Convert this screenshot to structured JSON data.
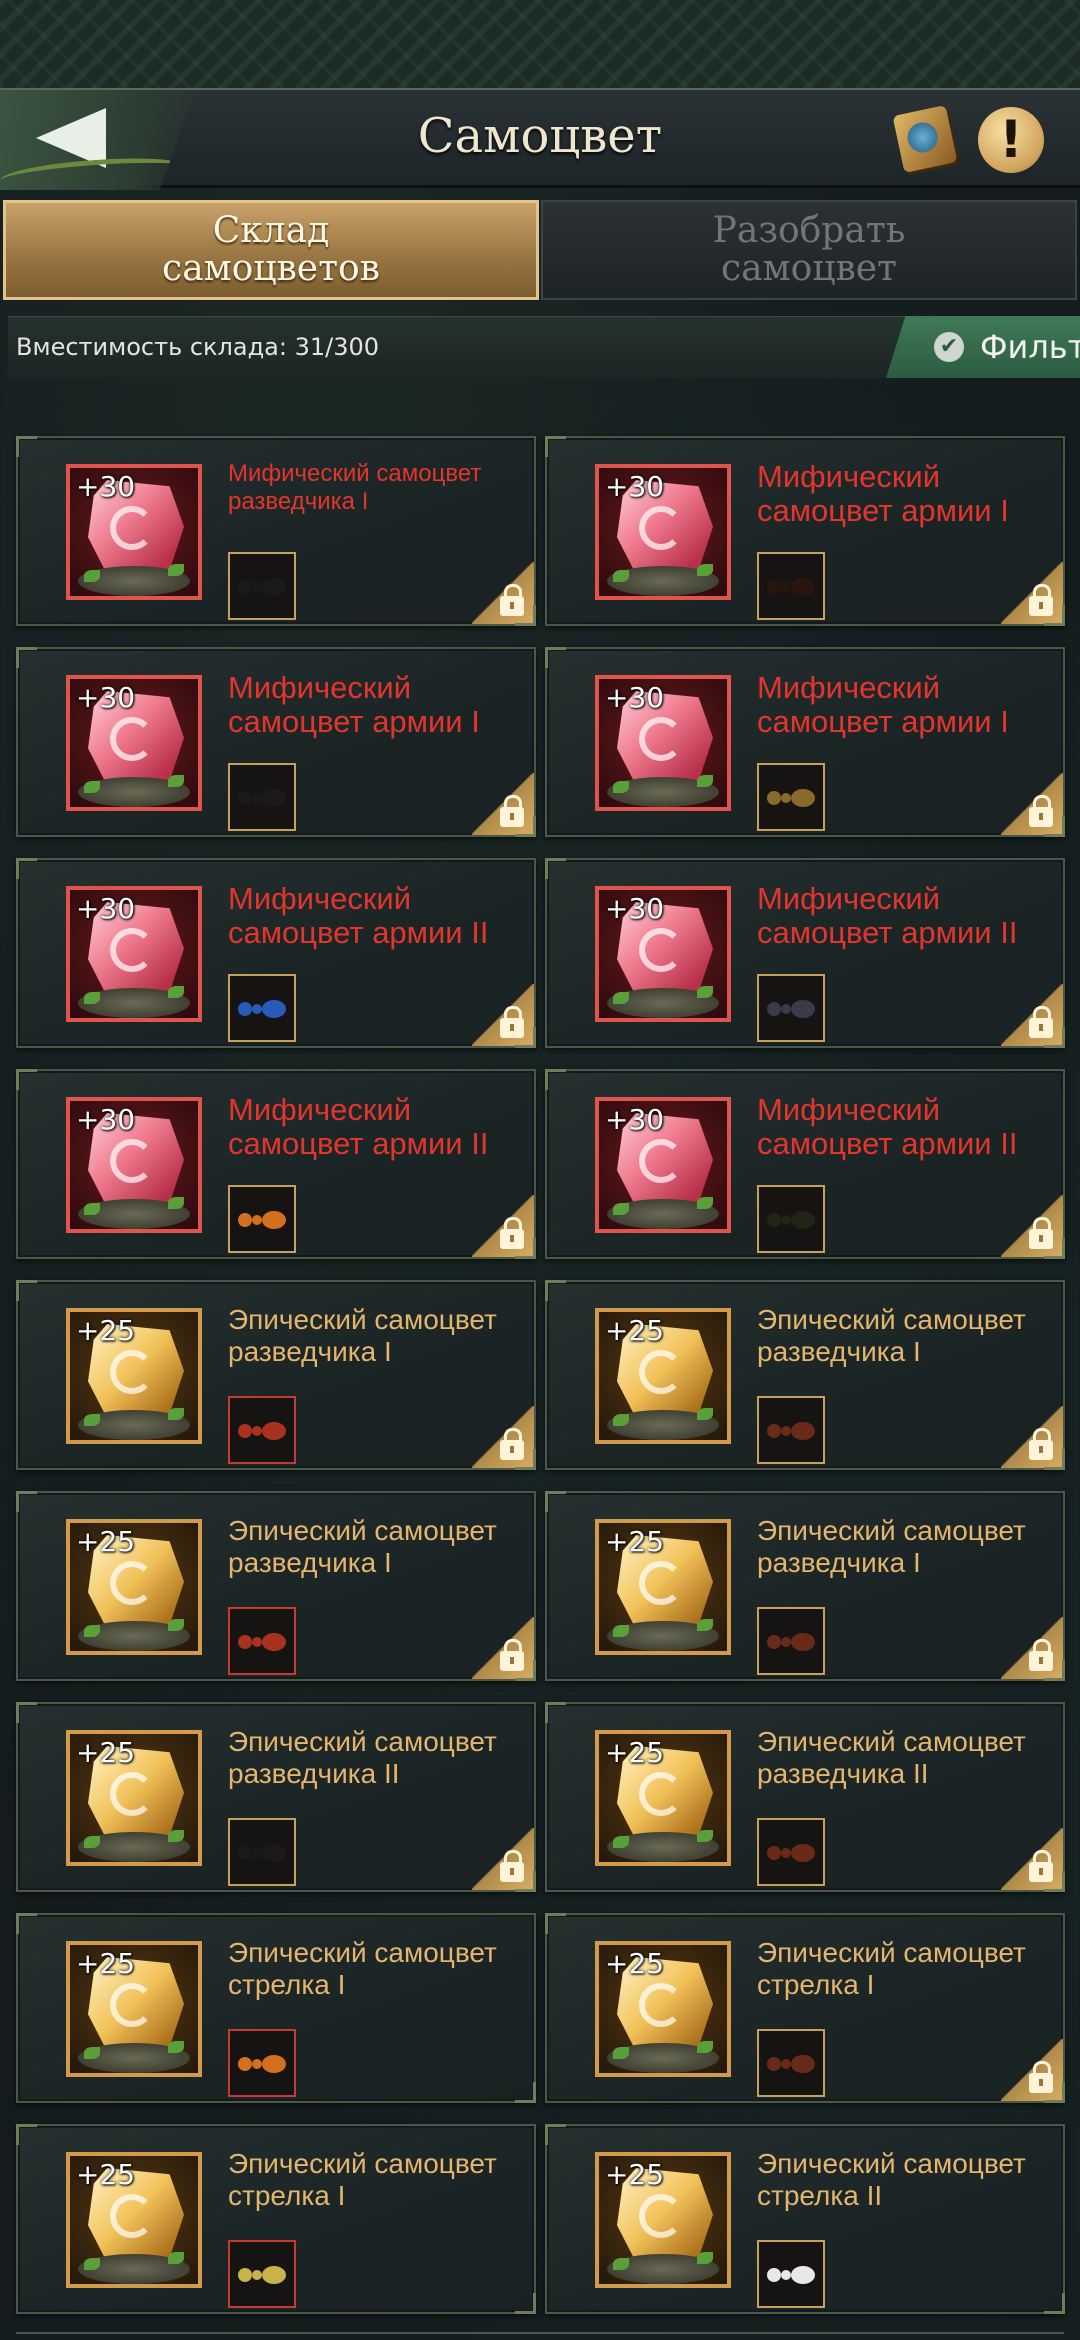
{
  "header": {
    "title": "Самоцвет",
    "back_icon": "back-arrow-icon",
    "book_icon": "gem-guide-book-icon",
    "info_icon": "info-exclamation-icon",
    "info_symbol": "!"
  },
  "tabs": [
    {
      "label": "Склад\nсамоцветов",
      "active": true
    },
    {
      "label": "Разобрать\nсамоцвет",
      "active": false
    }
  ],
  "capacity": {
    "text": "Вместимость склада: 31/300"
  },
  "filter": {
    "label": "Фильтр",
    "checked": true,
    "check_symbol": "✔"
  },
  "colors": {
    "mythic": "#e2352d",
    "epic": "#e4b56d",
    "filter": "#3f7a58",
    "active_tab": "#b38a52"
  },
  "gems": [
    {
      "bonus": "+30",
      "name": "Мифический самоцвет разведчика I",
      "rarity": "mythic",
      "unit": "black-ant",
      "locked": true
    },
    {
      "bonus": "+30",
      "name": "Мифический самоцвет армии I",
      "rarity": "mythic",
      "unit": "dark-beetle",
      "locked": true
    },
    {
      "bonus": "+30",
      "name": "Мифический самоцвет армии I",
      "rarity": "mythic",
      "unit": "black-ant",
      "locked": true
    },
    {
      "bonus": "+30",
      "name": "Мифический самоцвет армии I",
      "rarity": "mythic",
      "unit": "golden-spider",
      "locked": true
    },
    {
      "bonus": "+30",
      "name": "Мифический самоцвет армии II",
      "rarity": "mythic",
      "unit": "blue-ant",
      "locked": true
    },
    {
      "bonus": "+30",
      "name": "Мифический самоцвет армии II",
      "rarity": "mythic",
      "unit": "mantis",
      "locked": true
    },
    {
      "bonus": "+30",
      "name": "Мифический самоцвет армии II",
      "rarity": "mythic",
      "unit": "orange-ant",
      "locked": true
    },
    {
      "bonus": "+30",
      "name": "Мифический самоцвет армии II",
      "rarity": "mythic",
      "unit": "black-beetle",
      "locked": true
    },
    {
      "bonus": "+25",
      "name": "Эпический самоцвет разведчика I",
      "rarity": "epic",
      "unit": "red-ant",
      "locked": true
    },
    {
      "bonus": "+25",
      "name": "Эпический самоцвет разведчика I",
      "rarity": "epic",
      "unit": "brown-ant",
      "locked": true
    },
    {
      "bonus": "+25",
      "name": "Эпический самоцвет разведчика I",
      "rarity": "epic",
      "unit": "red-ant",
      "locked": true
    },
    {
      "bonus": "+25",
      "name": "Эпический самоцвет разведчика I",
      "rarity": "epic",
      "unit": "brown-ant",
      "locked": true
    },
    {
      "bonus": "+25",
      "name": "Эпический самоцвет разведчика II",
      "rarity": "epic",
      "unit": "black-ant",
      "locked": true
    },
    {
      "bonus": "+25",
      "name": "Эпический самоцвет разведчика II",
      "rarity": "epic",
      "unit": "brown-ant",
      "locked": true
    },
    {
      "bonus": "+25",
      "name": "Эпический самоцвет стрелка I",
      "rarity": "epic",
      "unit": "orange-ant",
      "locked": false
    },
    {
      "bonus": "+25",
      "name": "Эпический самоцвет стрелка I",
      "rarity": "epic",
      "unit": "brown-ant",
      "locked": true
    },
    {
      "bonus": "+25",
      "name": "Эпический самоцвет стрелка I",
      "rarity": "epic",
      "unit": "yellow-ant",
      "locked": false
    },
    {
      "bonus": "+25",
      "name": "Эпический самоцвет стрелка II",
      "rarity": "epic",
      "unit": "white-ant",
      "locked": false
    }
  ]
}
